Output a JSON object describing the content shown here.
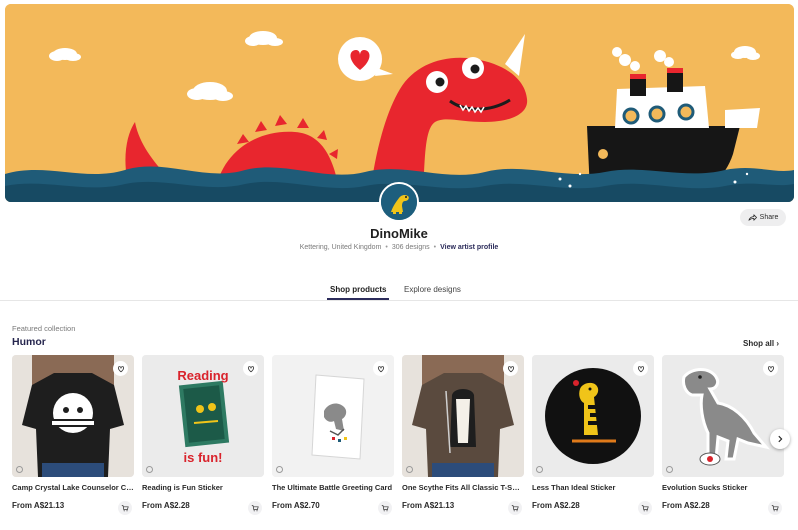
{
  "artist": {
    "name": "DinoMike",
    "location": "Kettering, United Kingdom",
    "designs": "306 designs",
    "view_profile": "View artist profile"
  },
  "actions": {
    "share_label": "Share"
  },
  "tabs": [
    {
      "label": "Shop products",
      "active": true
    },
    {
      "label": "Explore designs",
      "active": false
    }
  ],
  "collection": {
    "featured_label": "Featured collection",
    "title": "Humor",
    "shop_all": "Shop all"
  },
  "products": [
    {
      "title": "Camp Crystal Lake Counselor Classic T-Shirt",
      "price": "From A$21.13"
    },
    {
      "title": "Reading is Fun Sticker",
      "price": "From A$2.28",
      "art_text": [
        "Reading",
        "is fun!"
      ]
    },
    {
      "title": "The Ultimate Battle Greeting Card",
      "price": "From A$2.70"
    },
    {
      "title": "One Scythe Fits All Classic T-Shirt",
      "price": "From A$21.13"
    },
    {
      "title": "Less Than Ideal Sticker",
      "price": "From A$2.28"
    },
    {
      "title": "Evolution Sucks Sticker",
      "price": "From A$2.28"
    }
  ],
  "colors": {
    "accent": "#2b2b5a",
    "banner_sky": "#f3b95a",
    "dino_red": "#e8262e",
    "sea": "#1f5b78"
  },
  "icons": [
    "share-icon",
    "heart-icon",
    "cart-icon",
    "chevron-right-icon",
    "info-icon"
  ]
}
